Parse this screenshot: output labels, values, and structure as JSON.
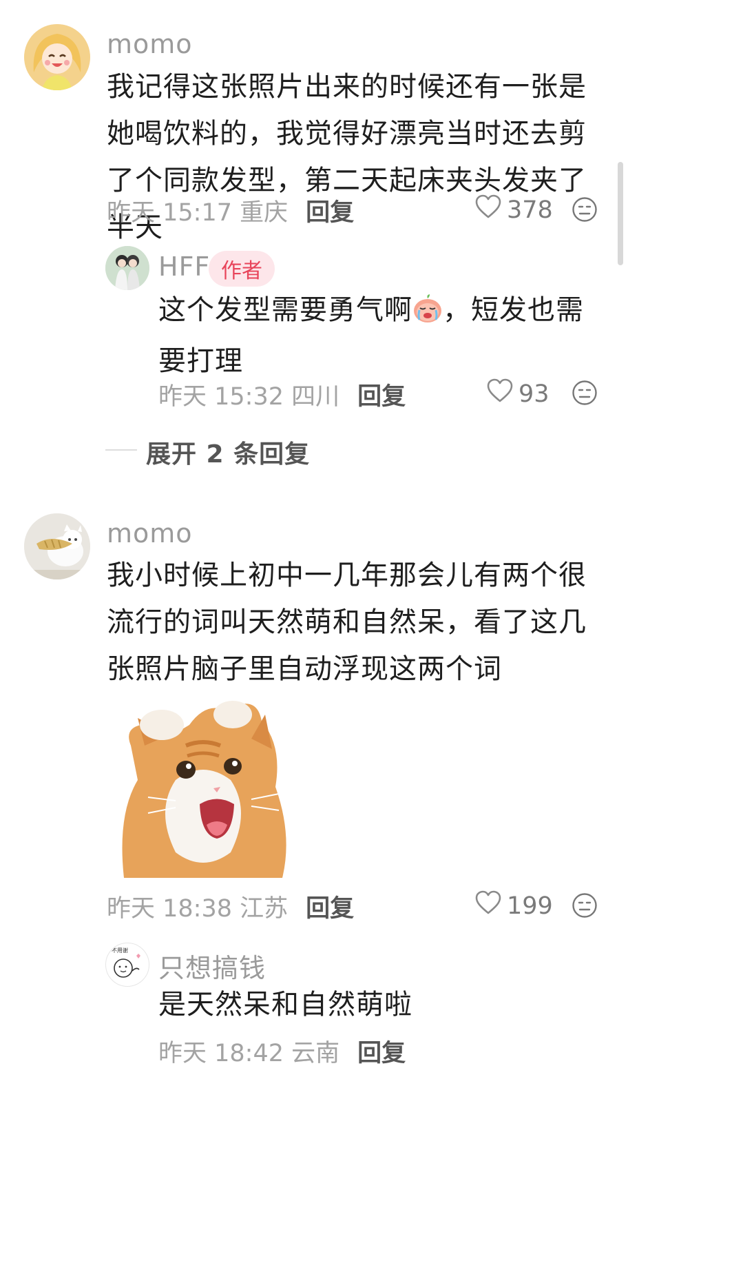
{
  "comments": [
    {
      "user": "momo",
      "text": "我记得这张照片出来的时候还有一张是她喝饮料的，我觉得好漂亮当时还去剪了个同款发型，第二天起床夹头发夹了半天",
      "time": "昨天 15:17 重庆",
      "reply_label": "回复",
      "likes": "378",
      "reply": {
        "user": "HFF",
        "badge": "作者",
        "text_before_emoji": "这个发型需要勇气啊",
        "text_after_emoji": "，短发也需要打理",
        "time": "昨天 15:32 四川",
        "reply_label": "回复",
        "likes": "93"
      },
      "expand_label": "展开 2 条回复"
    },
    {
      "user": "momo",
      "text": "我小时候上初中一几年那会儿有两个很流行的词叫天然萌和自然呆，看了这几张照片脑子里自动浮现这两个词",
      "time": "昨天 18:38 江苏",
      "reply_label": "回复",
      "likes": "199",
      "reply": {
        "user": "只想搞钱",
        "text": "是天然呆和自然萌啦",
        "time": "昨天 18:42 云南",
        "reply_label": "回复"
      }
    }
  ],
  "avatar3_text": "不用谢",
  "icons": {
    "like": "heart-outline-icon",
    "reaction": "neutral-face-icon",
    "reply_emoji": "crying-peach-emoji"
  },
  "colors": {
    "badge_bg": "#fde6ea",
    "badge_text": "#e8445a",
    "meta": "#a3a3a3"
  }
}
